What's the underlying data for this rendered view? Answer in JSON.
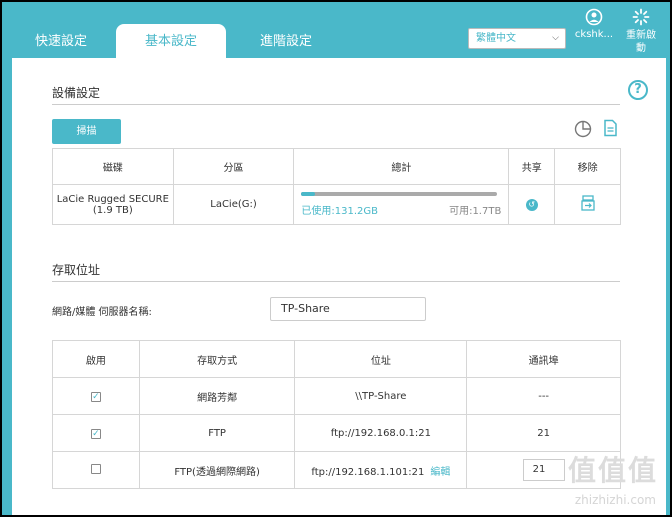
{
  "tabs": [
    {
      "label": "快速設定",
      "active": false
    },
    {
      "label": "基本設定",
      "active": true
    },
    {
      "label": "進階設定",
      "active": false
    }
  ],
  "header": {
    "language": "繁體中文",
    "user_label": "ckshk...",
    "reboot_label": "重新啟動"
  },
  "device": {
    "section_title": "設備設定",
    "scan_button": "掃描",
    "columns": [
      "磁碟",
      "分區",
      "總計",
      "共享",
      "移除"
    ],
    "row": {
      "disk": "LaCie Rugged SECURE",
      "disk_size": "(1.9 TB)",
      "partition": "LaCie(G:)",
      "used": "已使用:131.2GB",
      "available": "可用:1.7TB",
      "usage_fraction": 0.07
    }
  },
  "access": {
    "section_title": "存取位址",
    "server_name_label": "網路/媒體 伺服器名稱:",
    "server_name_value": "TP-Share",
    "columns": [
      "啟用",
      "存取方式",
      "位址",
      "通訊埠"
    ],
    "rows": [
      {
        "enabled": true,
        "method": "網路芳鄰",
        "address": "\\\\TP-Share",
        "port": "---",
        "edit": ""
      },
      {
        "enabled": true,
        "method": "FTP",
        "address": "ftp://192.168.0.1:21",
        "port": "21",
        "edit": ""
      },
      {
        "enabled": false,
        "method": "FTP(透過網際網路)",
        "address": "ftp://192.168.1.101:21",
        "port": "21",
        "edit": "編輯"
      }
    ]
  },
  "watermark": {
    "logo": "值值值",
    "domain": "zhizhizhi.com"
  },
  "colors": {
    "accent": "#4ab8c9",
    "frame": "#4ab8c9"
  }
}
